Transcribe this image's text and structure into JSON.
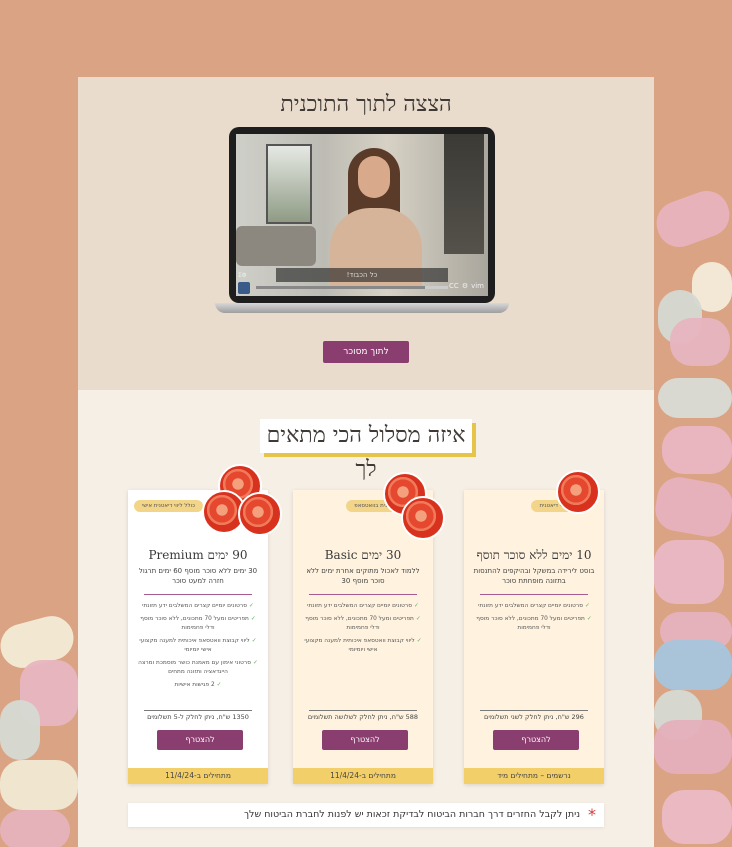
{
  "hero": {
    "title": "הצצה לתוך התוכנית",
    "video": {
      "caption": "כל הכבוד!",
      "controls": [
        "CC",
        "⚙",
        "vim"
      ],
      "side_label": "ΣΦ",
      "progress_fraction": 0.12
    },
    "cta_label": "לתוך מסוכר"
  },
  "section_title": "איזה מסלול הכי מתאים לך",
  "plans": [
    {
      "badge": "ללא ליווי דיאטנית",
      "name": "10 ימים ללא סוכר תוסף",
      "subtitle": "בוסט לירידה במשקל ובהיקפים להתנסות בתזונה מופחתת סוכר",
      "features": [
        "סרטונים יומיים קצרים המשלבים ידע תזונתי",
        "תפריטים ומעל 70 מתכונים, ללא סוכר מוסף ודלי פחמימות"
      ],
      "price": "296 ש\"ח, ניתן לחלק לשני תשלומים",
      "join_label": "להצטרף",
      "strip": "נרשמים – מתחילים מיד",
      "tomatoes": 1
    },
    {
      "badge": "ליווי דיאטנית בוואטסאפ",
      "name": "30 ימים Basic",
      "subtitle": "ללמוד לאכול מתוקים אחרת ימים ללא סוכר מוסף 30",
      "features": [
        "סרטונים יומיים קצרים המשלבים ידע תזונתי",
        "תפריטים ומעל 70 מתכונים, ללא סוכר מוסף ודלי פחמימות",
        "ליווי קבוצת וואטסאפ איכותית למענה מקצועי אישי ויומיומי"
      ],
      "price": "588 ש\"ח, ניתן לחלק לשלושה תשלומים",
      "join_label": "להצטרף",
      "strip": "מתחילים ב-11/4/24",
      "tomatoes": 2
    },
    {
      "badge": "כולל ליווי דיאטנית אישי",
      "name": "90 ימים Premium",
      "subtitle": "30 ימים ללא סוכר מוסף 60 ימים תרגול חזרה למעט סוכר",
      "features": [
        "סרטונים יומיים קצרים המשלבים ידע תזונתי",
        "תפריטים ומעל 70 מתכונים, ללא סוכר מוסף ודלי פחמימות",
        "ליווי קבוצת וואטסאפ איכותית למענה מקצועי אישי יומיומי",
        "סרטוני אימון עם מאמנת כושר מוסמכת ומרצה הייגדאציה ותזונה מתחים",
        "2 פגישות אישיות"
      ],
      "price": "1350 ש\"ח, ניתן לחלק ל-5 תשלומים",
      "join_label": "להצטרף",
      "strip": "מתחילים ב-11/4/24",
      "tomatoes": 3
    }
  ],
  "note": {
    "star": "*",
    "text": "ניתן לקבל החזרים דרך חברות הביטוח לבדיקת זכאות יש לפנות לחברת הביטוח שלך"
  },
  "colors": {
    "accent": "#8a3d6f",
    "highlight": "#f3cf6a",
    "background": "#d9a384"
  }
}
